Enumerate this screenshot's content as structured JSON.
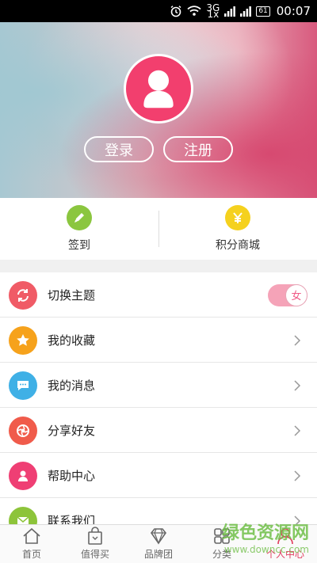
{
  "status_bar": {
    "network_top": "3G",
    "network_bottom": "1x",
    "battery": "61",
    "time": "00:07"
  },
  "hero": {
    "login_label": "登录",
    "register_label": "注册"
  },
  "quick_actions": [
    {
      "label": "签到",
      "color": "#8bc63f",
      "icon": "pencil-icon"
    },
    {
      "label": "积分商城",
      "color": "#f5d11e",
      "icon": "yen-icon"
    }
  ],
  "menu": [
    {
      "label": "切换主题",
      "color": "#f05b66",
      "icon": "refresh-icon",
      "toggle": "女"
    },
    {
      "label": "我的收藏",
      "color": "#f6a21c",
      "icon": "star-icon"
    },
    {
      "label": "我的消息",
      "color": "#3fb0e6",
      "icon": "chat-icon"
    },
    {
      "label": "分享好友",
      "color": "#f05b4b",
      "icon": "aperture-icon"
    },
    {
      "label": "帮助中心",
      "color": "#ef3f74",
      "icon": "person-icon"
    },
    {
      "label": "联系我们",
      "color": "#8dc43a",
      "icon": "mail-icon"
    }
  ],
  "tabbar": [
    {
      "label": "首页",
      "icon": "home-icon"
    },
    {
      "label": "值得买",
      "icon": "bag-icon"
    },
    {
      "label": "品牌团",
      "icon": "diamond-icon"
    },
    {
      "label": "分类",
      "icon": "grid-icon"
    },
    {
      "label": "个人中心",
      "icon": "user-icon",
      "active": true
    }
  ],
  "watermark": {
    "main": "绿色资源网",
    "url": "www.downcc.com"
  },
  "colors": {
    "accent": "#e13c5e",
    "avatar_bg": "#f23f6e"
  }
}
